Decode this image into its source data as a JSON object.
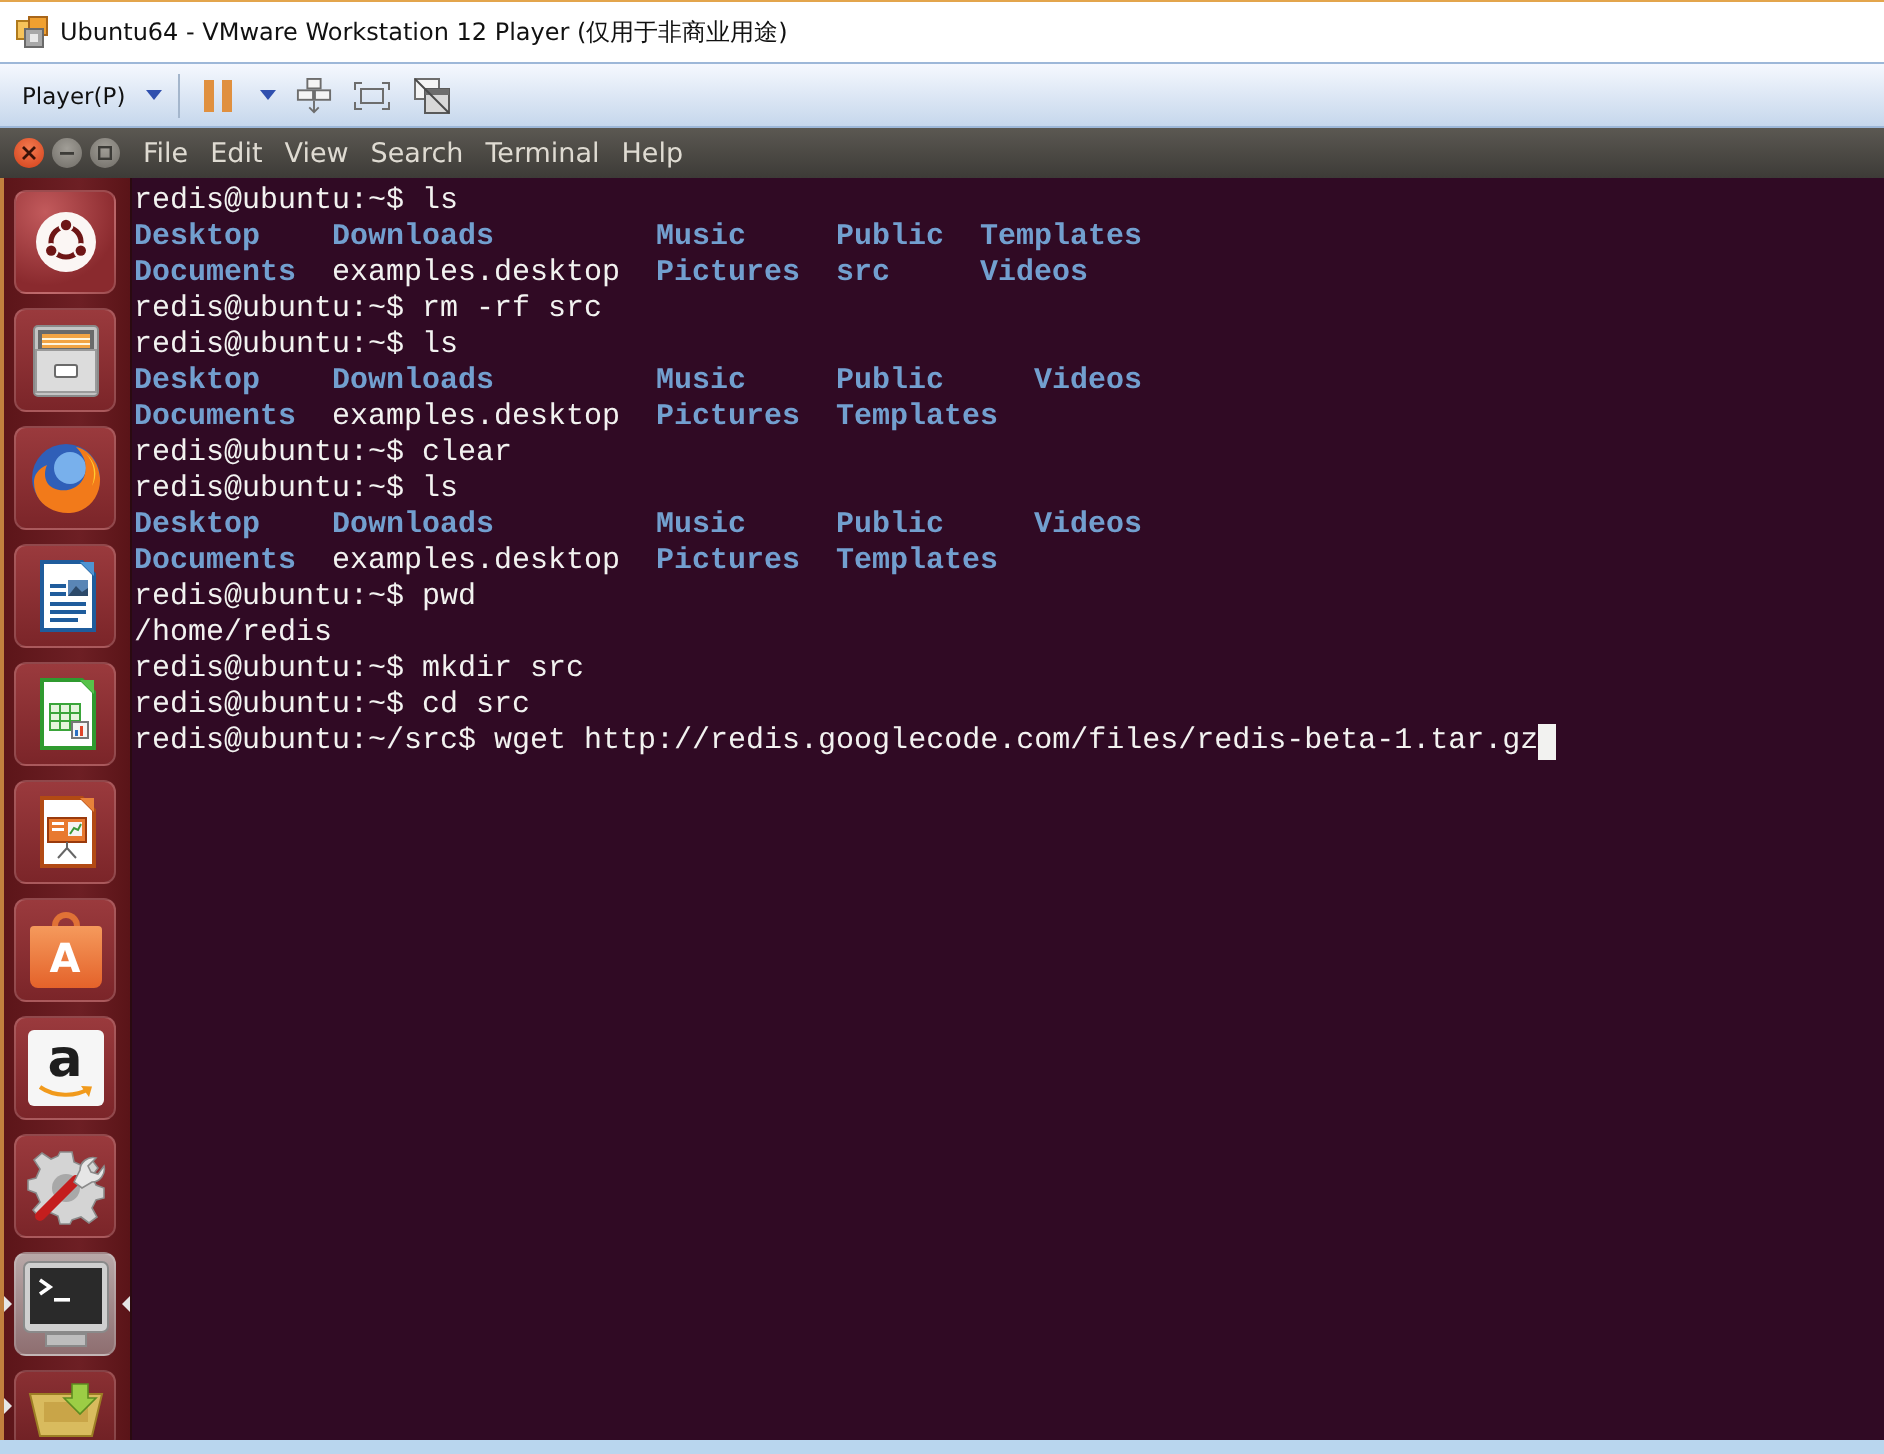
{
  "window": {
    "title": "Ubuntu64 - VMware Workstation 12 Player (仅用于非商业用途)"
  },
  "toolbar": {
    "player_menu": "Player(P)"
  },
  "launcher": {
    "items": [
      {
        "kind": "dash",
        "running": false,
        "focused": false
      },
      {
        "kind": "files",
        "running": false,
        "focused": false
      },
      {
        "kind": "browser",
        "running": false,
        "focused": false
      },
      {
        "kind": "writer",
        "running": false,
        "focused": false
      },
      {
        "kind": "spreadsheet",
        "running": false,
        "focused": false
      },
      {
        "kind": "presentation",
        "running": false,
        "focused": false
      },
      {
        "kind": "software",
        "letter": "A",
        "running": false,
        "focused": false
      },
      {
        "kind": "shop",
        "letter": "a",
        "running": false,
        "focused": false
      },
      {
        "kind": "settings",
        "running": false,
        "focused": false
      },
      {
        "kind": "terminal",
        "running": true,
        "focused": true
      },
      {
        "kind": "archive",
        "running": true,
        "focused": false
      }
    ]
  },
  "terminal": {
    "menu": [
      "File",
      "Edit",
      "View",
      "Search",
      "Terminal",
      "Help"
    ],
    "lines": [
      {
        "kind": "text",
        "text": "redis@ubuntu:~$ ls",
        "cursor": false
      },
      {
        "kind": "listing",
        "rows": [
          [
            {
              "name": "Desktop",
              "kind": "dir"
            },
            {
              "name": "Downloads",
              "kind": "dir"
            },
            {
              "name": "Music",
              "kind": "dir"
            },
            {
              "name": "Public",
              "kind": "dir"
            },
            {
              "name": "Templates",
              "kind": "dir"
            }
          ],
          [
            {
              "name": "Documents",
              "kind": "dir"
            },
            {
              "name": "examples.desktop",
              "kind": "file"
            },
            {
              "name": "Pictures",
              "kind": "dir"
            },
            {
              "name": "src",
              "kind": "dir"
            },
            {
              "name": "Videos",
              "kind": "dir"
            }
          ]
        ]
      },
      {
        "kind": "text",
        "text": "redis@ubuntu:~$ rm -rf src",
        "cursor": false
      },
      {
        "kind": "text",
        "text": "redis@ubuntu:~$ ls",
        "cursor": false
      },
      {
        "kind": "listing",
        "rows": [
          [
            {
              "name": "Desktop",
              "kind": "dir"
            },
            {
              "name": "Downloads",
              "kind": "dir"
            },
            {
              "name": "Music",
              "kind": "dir"
            },
            {
              "name": "Public",
              "kind": "dir"
            },
            {
              "name": "Videos",
              "kind": "dir"
            }
          ],
          [
            {
              "name": "Documents",
              "kind": "dir"
            },
            {
              "name": "examples.desktop",
              "kind": "file"
            },
            {
              "name": "Pictures",
              "kind": "dir"
            },
            {
              "name": "Templates",
              "kind": "dir"
            }
          ]
        ]
      },
      {
        "kind": "text",
        "text": "redis@ubuntu:~$ clear",
        "cursor": false
      },
      {
        "kind": "text",
        "text": "redis@ubuntu:~$ ls",
        "cursor": false
      },
      {
        "kind": "listing",
        "rows": [
          [
            {
              "name": "Desktop",
              "kind": "dir"
            },
            {
              "name": "Downloads",
              "kind": "dir"
            },
            {
              "name": "Music",
              "kind": "dir"
            },
            {
              "name": "Public",
              "kind": "dir"
            },
            {
              "name": "Videos",
              "kind": "dir"
            }
          ],
          [
            {
              "name": "Documents",
              "kind": "dir"
            },
            {
              "name": "examples.desktop",
              "kind": "file"
            },
            {
              "name": "Pictures",
              "kind": "dir"
            },
            {
              "name": "Templates",
              "kind": "dir"
            }
          ]
        ]
      },
      {
        "kind": "text",
        "text": "redis@ubuntu:~$ pwd",
        "cursor": false
      },
      {
        "kind": "text",
        "text": "/home/redis",
        "cursor": false
      },
      {
        "kind": "text",
        "text": "redis@ubuntu:~$ mkdir src",
        "cursor": false
      },
      {
        "kind": "text",
        "text": "redis@ubuntu:~$ cd src",
        "cursor": false
      },
      {
        "kind": "text",
        "text": "redis@ubuntu:~/src$ wget http://redis.googlecode.com/files/redis-beta-1.tar.gz",
        "cursor": true
      }
    ]
  }
}
